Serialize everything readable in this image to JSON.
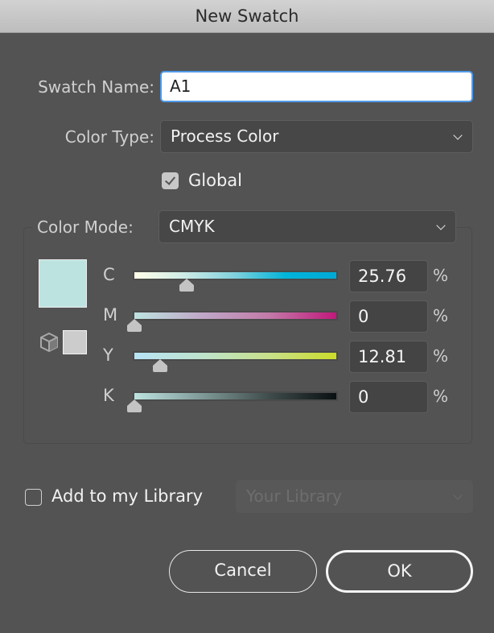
{
  "window": {
    "title": "New Swatch"
  },
  "swatch_name": {
    "label": "Swatch Name:",
    "value": "A1"
  },
  "color_type": {
    "label": "Color Type:",
    "selected": "Process Color"
  },
  "global": {
    "label": "Global",
    "checked": true
  },
  "color_mode": {
    "label": "Color Mode:",
    "selected": "CMYK"
  },
  "preview": {
    "swatch_color": "#bde3e0",
    "gamut_swatch_color": "#cccccc",
    "gamut_icon": "cube-icon"
  },
  "channels": [
    {
      "key": "c",
      "label": "C",
      "value": "25.76",
      "percent": 25.76,
      "unit": "%",
      "gradient": [
        "#fffde8",
        "#cdebe6",
        "#7fd0dc",
        "#00b4da",
        "#00a9d6"
      ]
    },
    {
      "key": "m",
      "label": "M",
      "value": "0",
      "percent": 0,
      "unit": "%",
      "gradient": [
        "#bde3e0",
        "#c0a8c8",
        "#c27aa8",
        "#c2187c"
      ]
    },
    {
      "key": "y",
      "label": "Y",
      "value": "12.81",
      "percent": 12.81,
      "unit": "%",
      "gradient": [
        "#b8e3f6",
        "#bee3cc",
        "#c8e08a",
        "#cbdc2a"
      ]
    },
    {
      "key": "k",
      "label": "K",
      "value": "0",
      "percent": 0,
      "unit": "%",
      "gradient": [
        "#bde3e0",
        "#7f9a98",
        "#3f4c4b",
        "#0a1011"
      ]
    }
  ],
  "library": {
    "label": "Add to my Library",
    "checked": false,
    "select_placeholder": "Your Library",
    "disabled": true
  },
  "buttons": {
    "cancel": "Cancel",
    "ok": "OK"
  }
}
